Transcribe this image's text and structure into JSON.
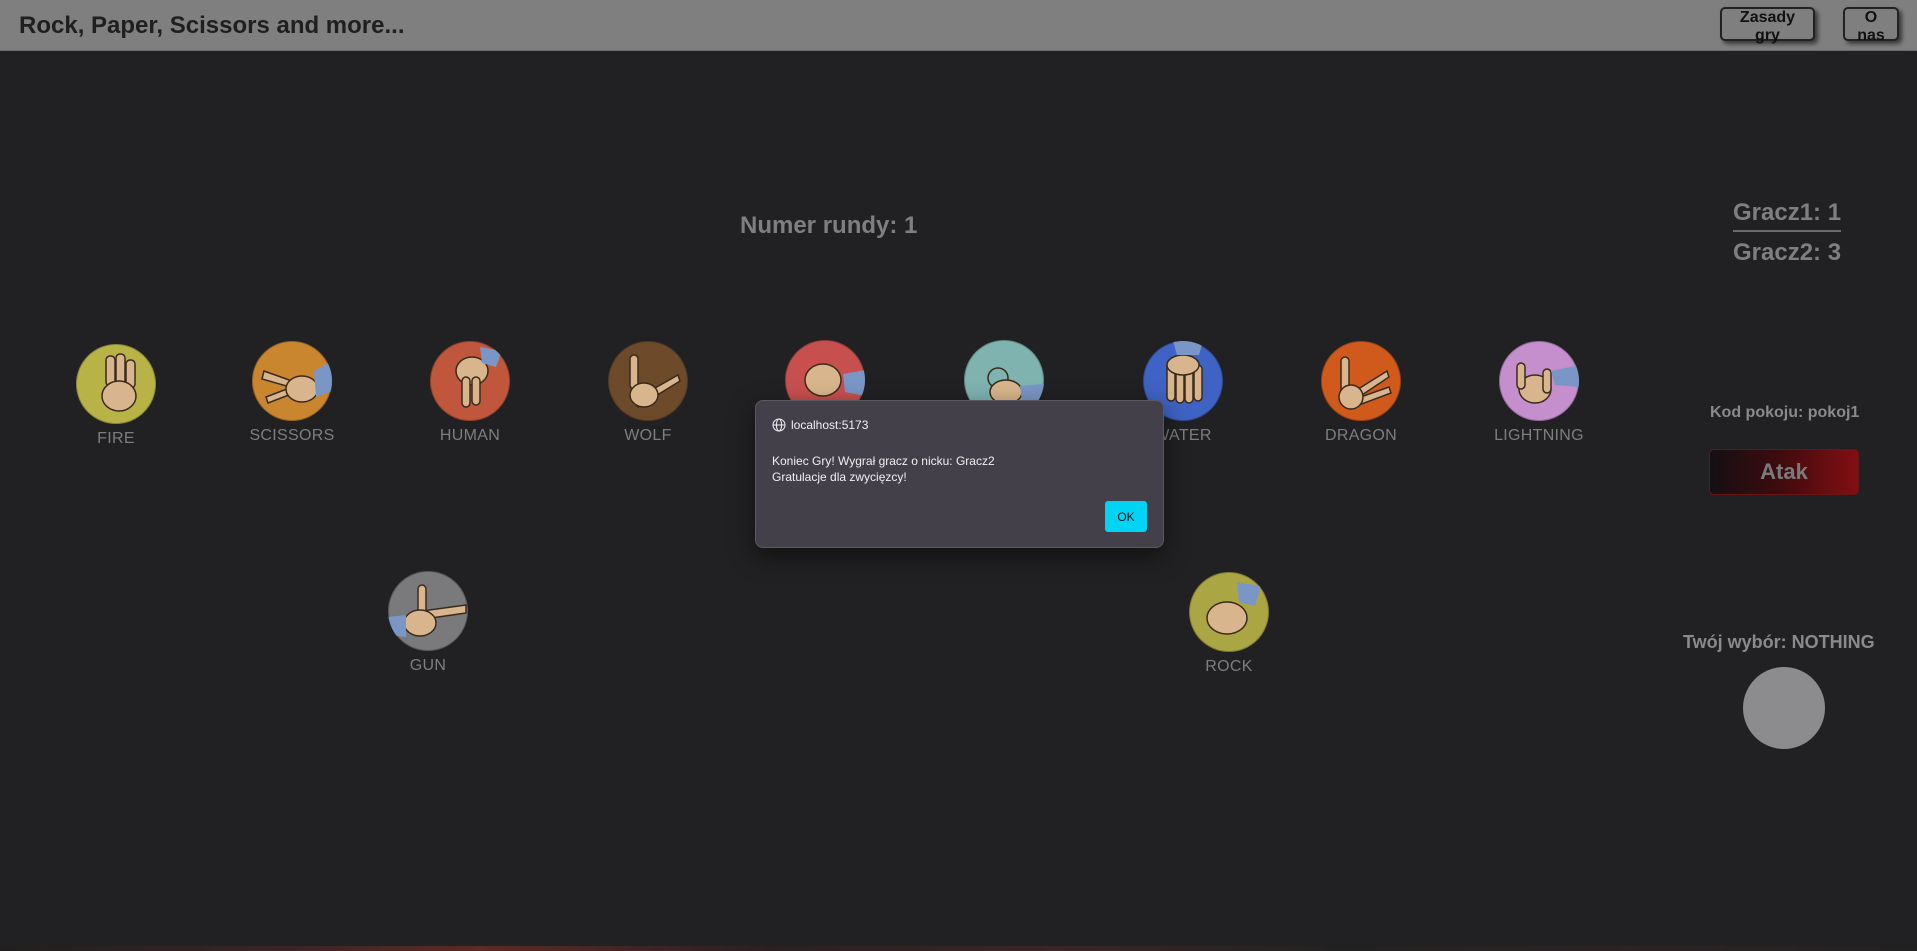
{
  "header": {
    "title": "Rock, Paper, Scissors and more...",
    "rules_label": "Zasady gry",
    "about_label": "O nas"
  },
  "game": {
    "round_label": "Numer rundy: 1",
    "scores": [
      "Gracz1: 1",
      "Gracz2: 3"
    ],
    "room_label": "Kod pokoju: pokoj1",
    "attack_label": "Atak",
    "choice_label": "Twój wybór: NOTHING"
  },
  "gestures": [
    {
      "label": "FIRE",
      "color": "#b7b347"
    },
    {
      "label": "SCISSORS",
      "color": "#c9862f"
    },
    {
      "label": "HUMAN",
      "color": "#c0573c"
    },
    {
      "label": "WOLF",
      "color": "#6c4a2a"
    },
    {
      "label": "",
      "color": "#c7504f"
    },
    {
      "label": "",
      "color": "#7fb3b0"
    },
    {
      "label": "WATER",
      "color": "#3f63c4"
    },
    {
      "label": "DRAGON",
      "color": "#d05a1c"
    },
    {
      "label": "LIGHTNING",
      "color": "#c58fce"
    },
    {
      "label": "GUN",
      "color": "#7a7a7d"
    },
    {
      "label": "ROCK",
      "color": "#a9a643"
    }
  ],
  "dialog": {
    "origin": "localhost:5173",
    "message": "Koniec Gry! Wygrał gracz o nicku: Gracz2\nGratulacje dla zwycięzcy!",
    "ok_label": "OK"
  }
}
